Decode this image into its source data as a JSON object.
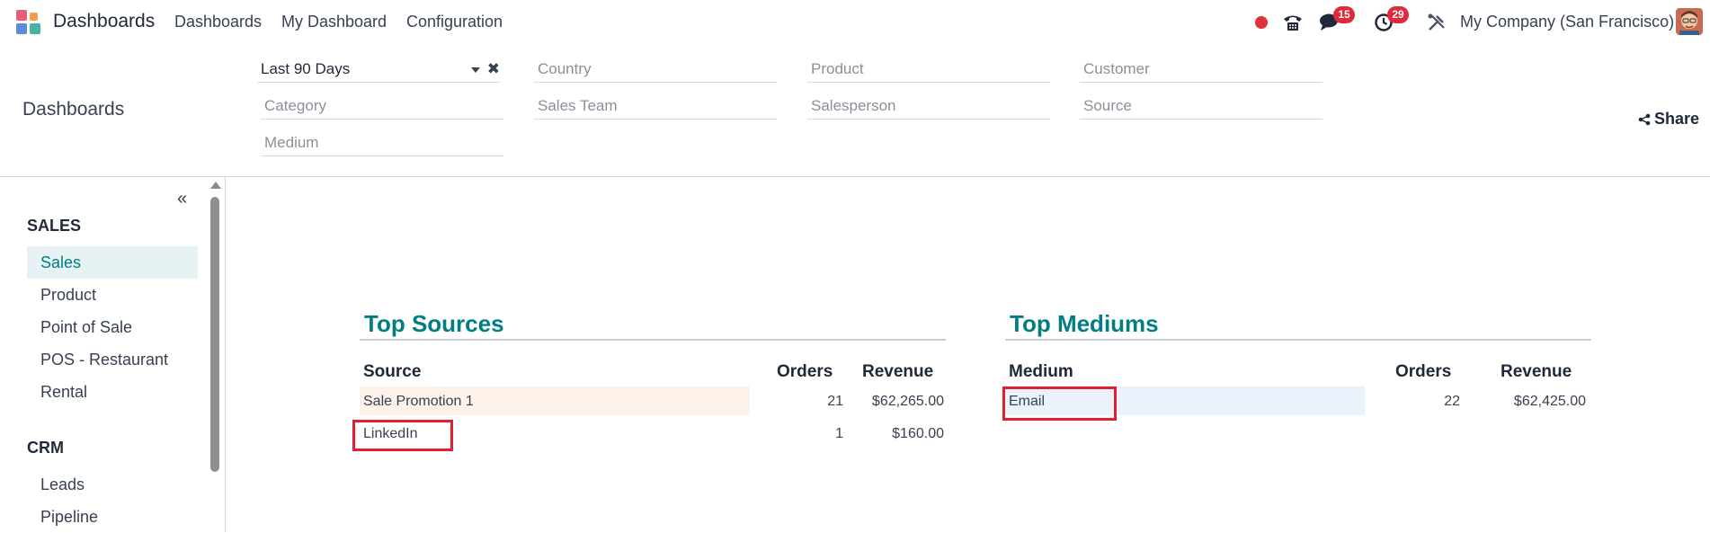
{
  "navbar": {
    "app_title": "Dashboards",
    "links": [
      "Dashboards",
      "My Dashboard",
      "Configuration"
    ],
    "messages_badge": "15",
    "activities_badge": "29",
    "company": "My Company (San Francisco)"
  },
  "control_panel": {
    "breadcrumb": "Dashboards",
    "share_label": "Share",
    "filters": {
      "date": "Last 90 Days",
      "country": "Country",
      "product": "Product",
      "customer": "Customer",
      "category": "Category",
      "sales_team": "Sales Team",
      "salesperson": "Salesperson",
      "source": "Source",
      "medium": "Medium"
    }
  },
  "sidebar": {
    "sections": [
      {
        "title": "SALES",
        "items": [
          "Sales",
          "Product",
          "Point of Sale",
          "POS - Restaurant",
          "Rental"
        ]
      },
      {
        "title": "CRM",
        "items": [
          "Leads",
          "Pipeline"
        ]
      }
    ],
    "active_item": "Sales"
  },
  "top_sources": {
    "title": "Top Sources",
    "headers": {
      "name": "Source",
      "orders": "Orders",
      "revenue": "Revenue"
    },
    "rows": [
      {
        "name": "Sale Promotion 1",
        "orders": "21",
        "revenue": "$62,265.00",
        "share": 1.0
      },
      {
        "name": "LinkedIn",
        "orders": "1",
        "revenue": "$160.00",
        "share": 0.0
      }
    ]
  },
  "top_mediums": {
    "title": "Top Mediums",
    "headers": {
      "name": "Medium",
      "orders": "Orders",
      "revenue": "Revenue"
    },
    "rows": [
      {
        "name": "Email",
        "orders": "22",
        "revenue": "$62,425.00",
        "share": 1.0
      }
    ]
  },
  "colors": {
    "accent": "#017e84",
    "badge": "#e0293b",
    "highlight_box": "#e0202f",
    "source_bar": "#fdf3ea",
    "medium_bar": "#eaf3fb"
  }
}
